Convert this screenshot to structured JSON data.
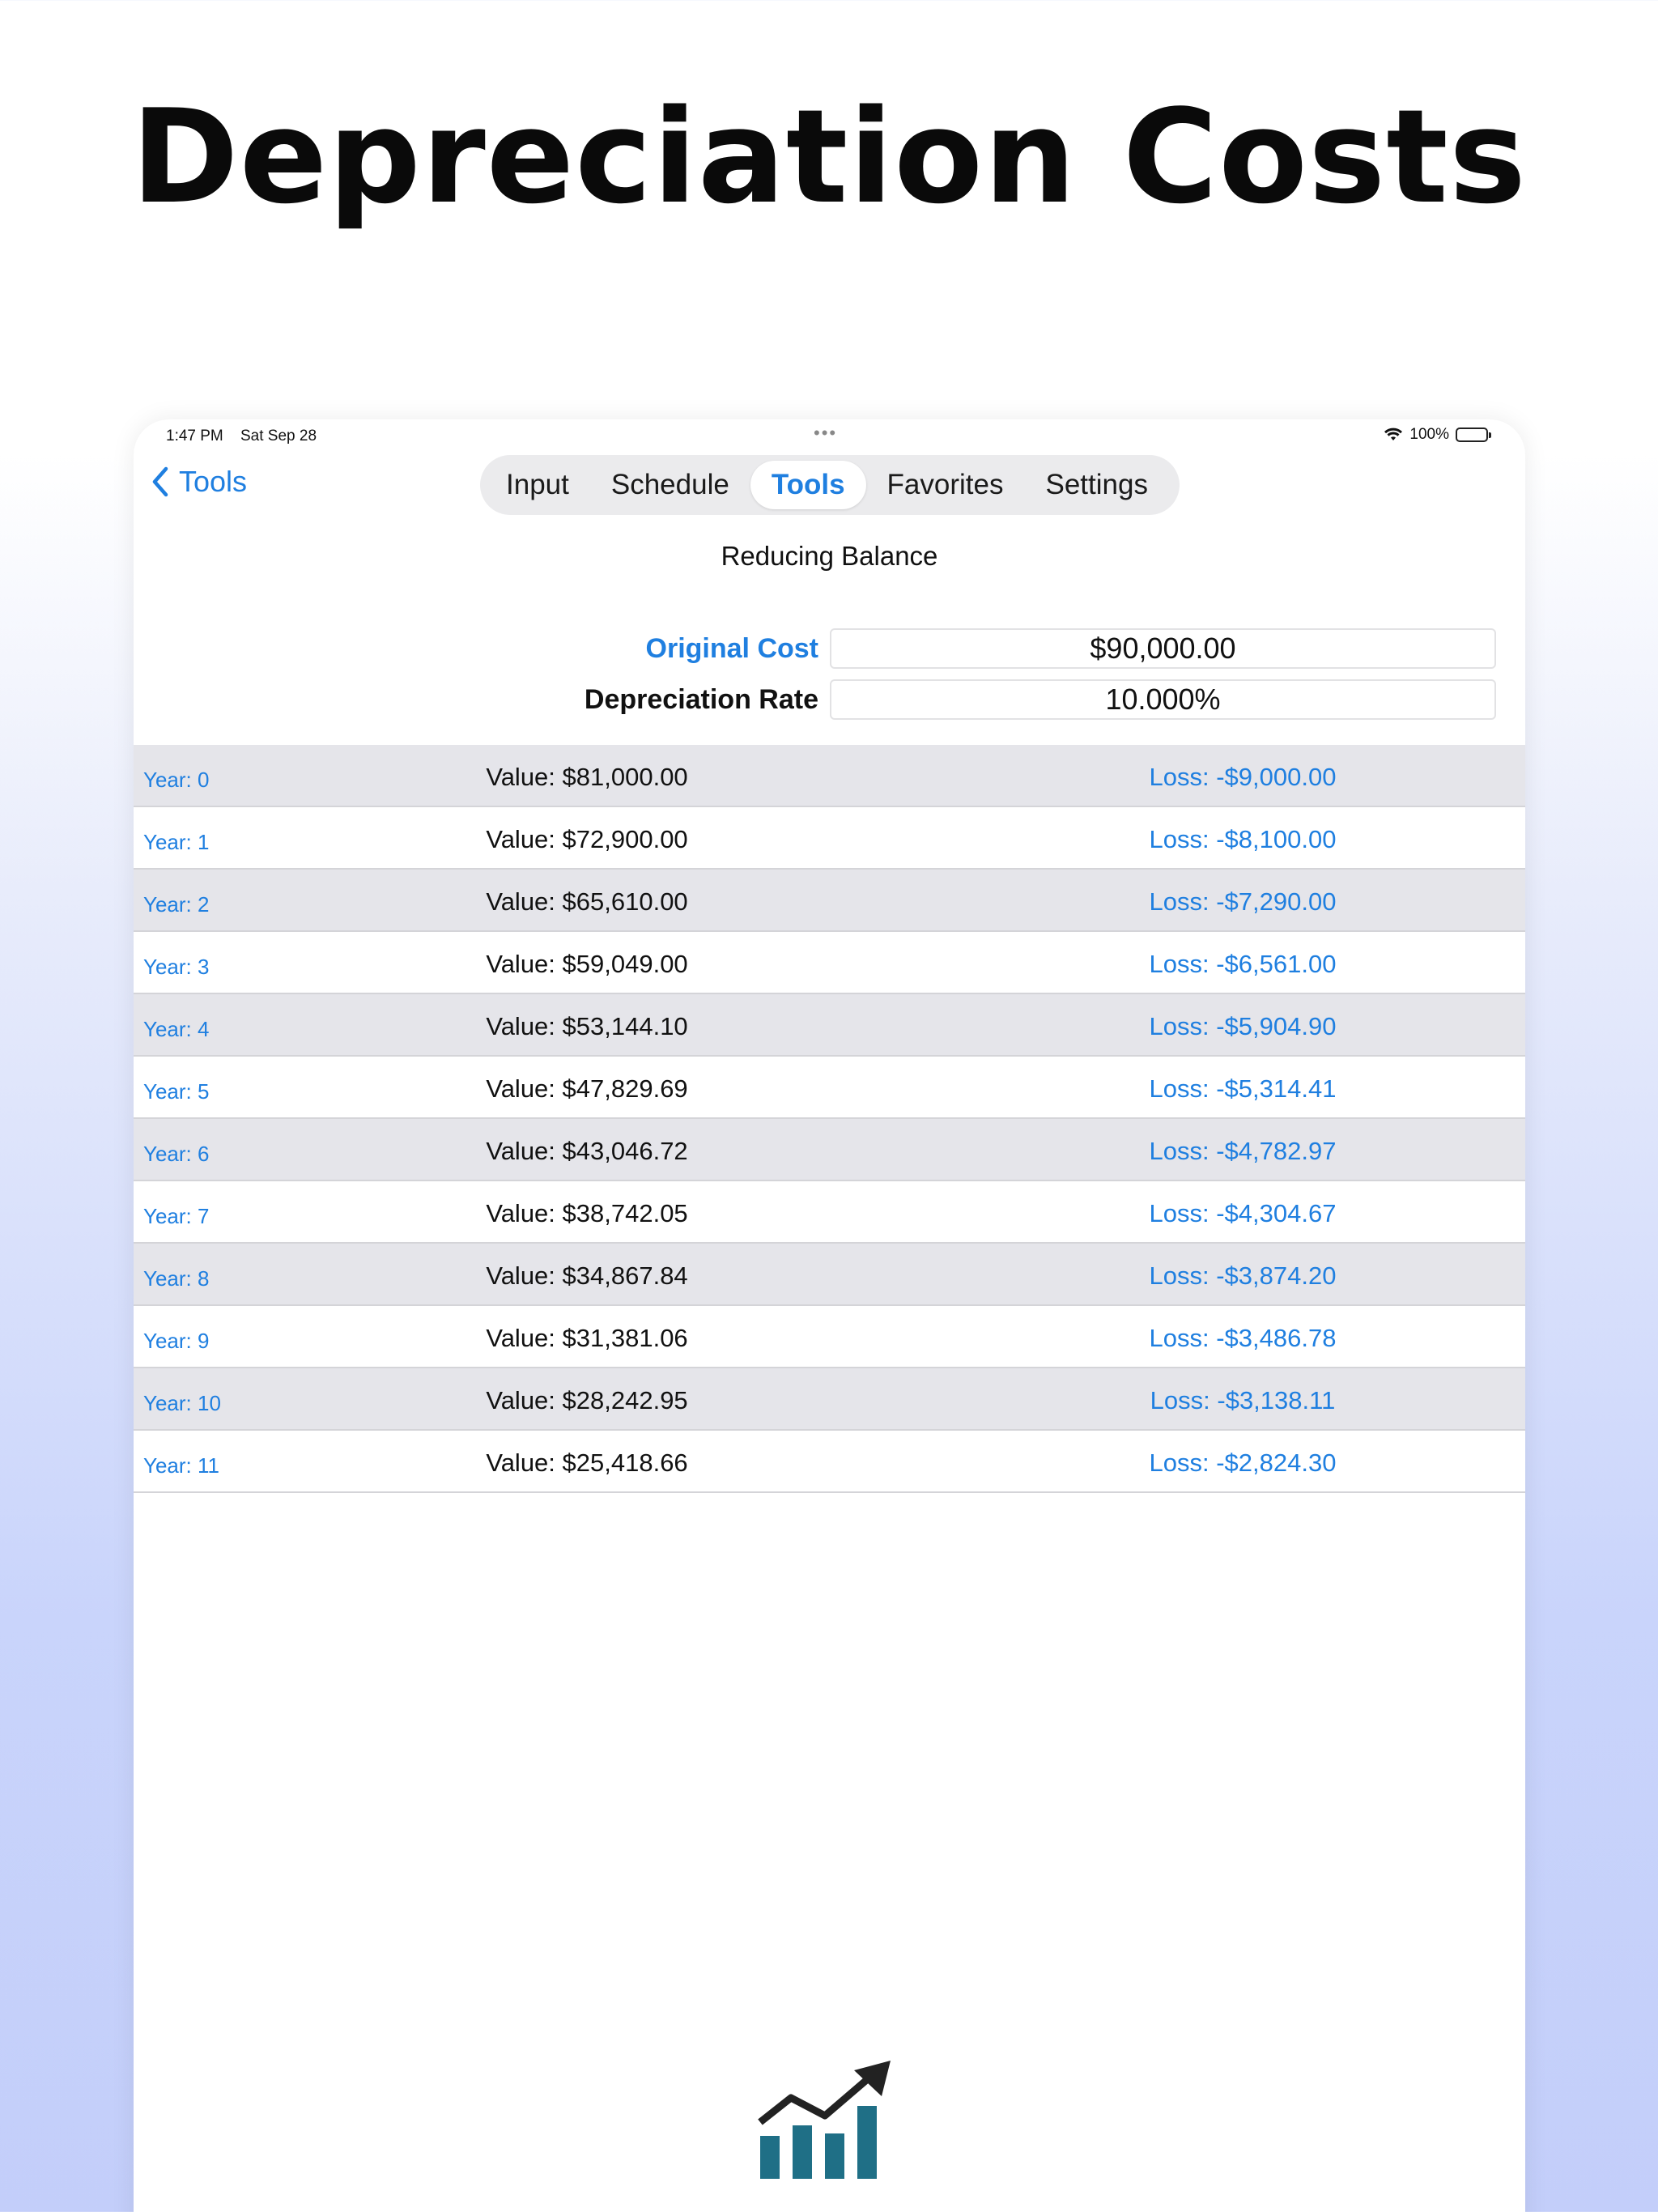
{
  "headline": "Depreciation Costs",
  "status": {
    "time": "1:47 PM",
    "date": "Sat Sep 28",
    "battery": "100%"
  },
  "nav": {
    "back_label": "Tools",
    "tabs": [
      {
        "label": "Input",
        "active": false
      },
      {
        "label": "Schedule",
        "active": false
      },
      {
        "label": "Tools",
        "active": true
      },
      {
        "label": "Favorites",
        "active": false
      },
      {
        "label": "Settings",
        "active": false
      }
    ]
  },
  "section_title": "Reducing Balance",
  "fields": {
    "original_cost_label": "Original Cost",
    "original_cost_value": "$90,000.00",
    "rate_label": "Depreciation Rate",
    "rate_value": "10.000%"
  },
  "rows": [
    {
      "year": "Year: 0",
      "value": "Value: $81,000.00",
      "loss": "Loss: -$9,000.00"
    },
    {
      "year": "Year: 1",
      "value": "Value: $72,900.00",
      "loss": "Loss: -$8,100.00"
    },
    {
      "year": "Year: 2",
      "value": "Value: $65,610.00",
      "loss": "Loss: -$7,290.00"
    },
    {
      "year": "Year: 3",
      "value": "Value: $59,049.00",
      "loss": "Loss: -$6,561.00"
    },
    {
      "year": "Year: 4",
      "value": "Value: $53,144.10",
      "loss": "Loss: -$5,904.90"
    },
    {
      "year": "Year: 5",
      "value": "Value: $47,829.69",
      "loss": "Loss: -$5,314.41"
    },
    {
      "year": "Year: 6",
      "value": "Value: $43,046.72",
      "loss": "Loss: -$4,782.97"
    },
    {
      "year": "Year: 7",
      "value": "Value: $38,742.05",
      "loss": "Loss: -$4,304.67"
    },
    {
      "year": "Year: 8",
      "value": "Value: $34,867.84",
      "loss": "Loss: -$3,874.20"
    },
    {
      "year": "Year: 9",
      "value": "Value: $31,381.06",
      "loss": "Loss: -$3,486.78"
    },
    {
      "year": "Year: 10",
      "value": "Value: $28,242.95",
      "loss": "Loss: -$3,138.11"
    },
    {
      "year": "Year: 11",
      "value": "Value: $25,418.66",
      "loss": "Loss: -$2,824.30"
    }
  ],
  "colors": {
    "accent": "#1f7fe0",
    "row_shade": "#e5e5ea",
    "logo_bars": "#1f6f86",
    "logo_arrow": "#222222"
  },
  "logo_icon": "growth-chart-icon"
}
